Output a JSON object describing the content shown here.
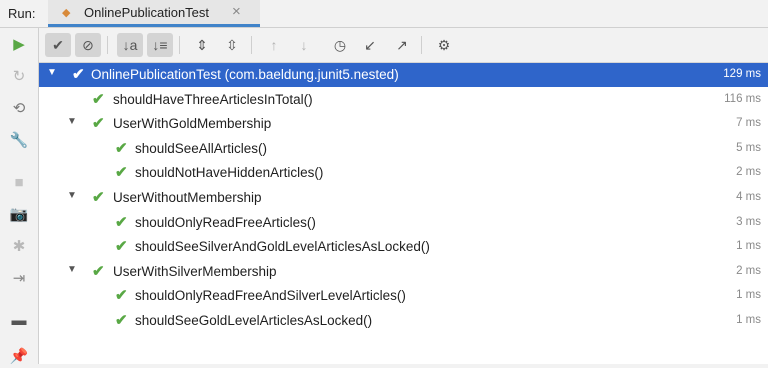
{
  "run_panel": {
    "label": "Run:",
    "tab": {
      "title": "OnlinePublicationTest",
      "icon": "run-config-icon",
      "close_glyph": "×"
    }
  },
  "sidebar_icons": [
    {
      "icon": "rerun-icon",
      "glyph": "▶",
      "color": "#59a845"
    },
    {
      "icon": "rerun-failed-icon",
      "glyph": "↻",
      "color": "#b8b8b8"
    },
    {
      "icon": "toggle-auto-test-icon",
      "glyph": "⟲",
      "color": "#7a7a7a"
    },
    {
      "icon": "settings-wrench-icon",
      "glyph": "🔧",
      "color": "#6a6a6a"
    },
    {
      "icon": "stop-icon",
      "glyph": "■",
      "color": "#c4c4c4"
    },
    {
      "icon": "camera-icon",
      "glyph": "📷",
      "color": "#b8b8b8"
    },
    {
      "icon": "bug-icon",
      "glyph": "✱",
      "color": "#b8b8b8"
    },
    {
      "icon": "exit-icon",
      "glyph": "⇥",
      "color": "#8a8a8a"
    },
    {
      "icon": "layout-icon",
      "glyph": "▬",
      "color": "#555555"
    },
    {
      "icon": "pin-icon",
      "glyph": "📌",
      "color": "#555555"
    }
  ],
  "toolbar": [
    {
      "icon": "show-passed-icon",
      "glyph": "✔",
      "active": true
    },
    {
      "icon": "show-ignored-icon",
      "glyph": "⊘",
      "active": true
    },
    {
      "icon": "sort-alphabetically-icon",
      "glyph": "↓a",
      "active": true
    },
    {
      "icon": "sort-by-duration-icon",
      "glyph": "↓≡",
      "active": true
    },
    {
      "icon": "expand-all-icon",
      "glyph": "⇕",
      "active": false
    },
    {
      "icon": "collapse-all-icon",
      "glyph": "⇳",
      "active": false
    },
    {
      "icon": "previous-failed-icon",
      "glyph": "↑",
      "active": false,
      "dim": true
    },
    {
      "icon": "next-failed-icon",
      "glyph": "↓",
      "active": false,
      "dim": true
    },
    {
      "icon": "test-history-icon",
      "glyph": "◷",
      "active": false
    },
    {
      "icon": "import-tests-icon",
      "glyph": "↙",
      "active": false
    },
    {
      "icon": "export-results-icon",
      "glyph": "↗",
      "active": false
    },
    {
      "icon": "settings-gear-icon",
      "glyph": "⚙",
      "active": false
    }
  ],
  "tests": [
    {
      "name": "OnlinePublicationTest (com.baeldung.junit5.nested)",
      "duration": "129 ms",
      "level": 0,
      "expandable": true,
      "selected": true
    },
    {
      "name": "shouldHaveThreeArticlesInTotal()",
      "duration": "116 ms",
      "level": 1,
      "expandable": false
    },
    {
      "name": "UserWithGoldMembership",
      "duration": "7 ms",
      "level": 1,
      "expandable": true
    },
    {
      "name": "shouldSeeAllArticles()",
      "duration": "5 ms",
      "level": 2,
      "expandable": false
    },
    {
      "name": "shouldNotHaveHiddenArticles()",
      "duration": "2 ms",
      "level": 2,
      "expandable": false
    },
    {
      "name": "UserWithoutMembership",
      "duration": "4 ms",
      "level": 1,
      "expandable": true
    },
    {
      "name": "shouldOnlyReadFreeArticles()",
      "duration": "3 ms",
      "level": 2,
      "expandable": false
    },
    {
      "name": "shouldSeeSilverAndGoldLevelArticlesAsLocked()",
      "duration": "1 ms",
      "level": 2,
      "expandable": false
    },
    {
      "name": "UserWithSilverMembership",
      "duration": "2 ms",
      "level": 1,
      "expandable": true
    },
    {
      "name": "shouldOnlyReadFreeAndSilverLevelArticles()",
      "duration": "1 ms",
      "level": 2,
      "expandable": false
    },
    {
      "name": "shouldSeeGoldLevelArticlesAsLocked()",
      "duration": "1 ms",
      "level": 2,
      "expandable": false
    }
  ],
  "colors": {
    "selection": "#2f65ca",
    "pass": "#59a845",
    "tab_underline": "#4083c9"
  }
}
